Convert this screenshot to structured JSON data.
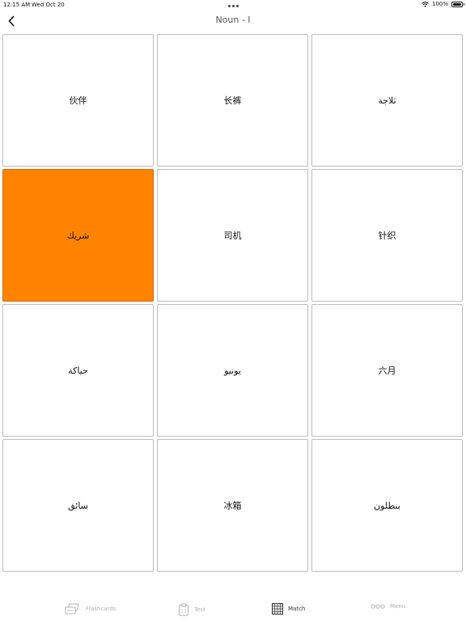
{
  "status": {
    "time": "12:15 AM",
    "date": "Wed Oct 20",
    "battery": "100%"
  },
  "nav": {
    "title": "Noun - I"
  },
  "cards": [
    {
      "text": "伙伴",
      "selected": false
    },
    {
      "text": "长裤",
      "selected": false
    },
    {
      "text": "ثلاجة",
      "selected": false
    },
    {
      "text": "شريك",
      "selected": true
    },
    {
      "text": "司机",
      "selected": false
    },
    {
      "text": "针织",
      "selected": false
    },
    {
      "text": "حياكة",
      "selected": false
    },
    {
      "text": "يونيو",
      "selected": false
    },
    {
      "text": "六月",
      "selected": false
    },
    {
      "text": "سائق",
      "selected": false
    },
    {
      "text": "冰箱",
      "selected": false
    },
    {
      "text": "بنطلون",
      "selected": false
    }
  ],
  "tabs": [
    {
      "label": "Flashcards",
      "icon": "flashcards-icon",
      "active": false
    },
    {
      "label": "Test",
      "icon": "test-icon",
      "active": false
    },
    {
      "label": "Match",
      "icon": "grid-icon",
      "active": true
    },
    {
      "label": "Menu",
      "icon": "more-icon",
      "active": false
    }
  ],
  "colors": {
    "selected_card": "#ff8200",
    "card_border": "#bdbdbd"
  }
}
